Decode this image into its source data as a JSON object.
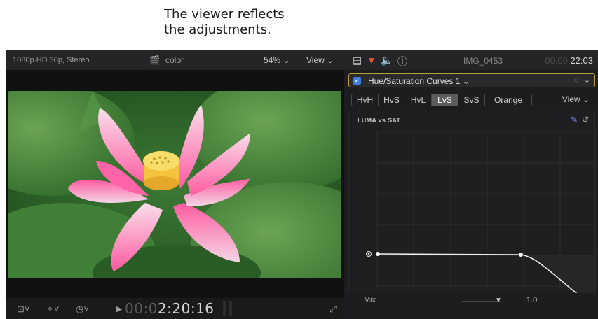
{
  "annotations": {
    "top_line1": "The viewer reflects",
    "top_line2": "the adjustments."
  },
  "viewer": {
    "format": "1080p HD 30p, Stereo",
    "clip_name": "color",
    "zoom": "54%",
    "view_label": "View",
    "timecode_dim": "00:0",
    "timecode": "2:20:16"
  },
  "inspector": {
    "clip_name": "IMG_0453",
    "timecode_dim": "00:00:",
    "timecode": "22:03",
    "effect_name": "Hue/Saturation Curves 1",
    "tabs": [
      "HvH",
      "HvS",
      "HvL",
      "LvS",
      "SvS",
      "Orange"
    ],
    "active_tab": "LvS",
    "view_label": "View",
    "curve_label": "LUMA vs SAT",
    "mix_label": "Mix",
    "mix_value": "1.0"
  },
  "curve": {
    "description_points": [
      [
        0.0,
        0.5
      ],
      [
        0.63,
        0.5
      ],
      [
        1.0,
        0.0
      ]
    ]
  },
  "mix_level": 1.0,
  "colors": {
    "accent_blue": "#3d7de0",
    "selection_yellow": "#b9a233"
  }
}
